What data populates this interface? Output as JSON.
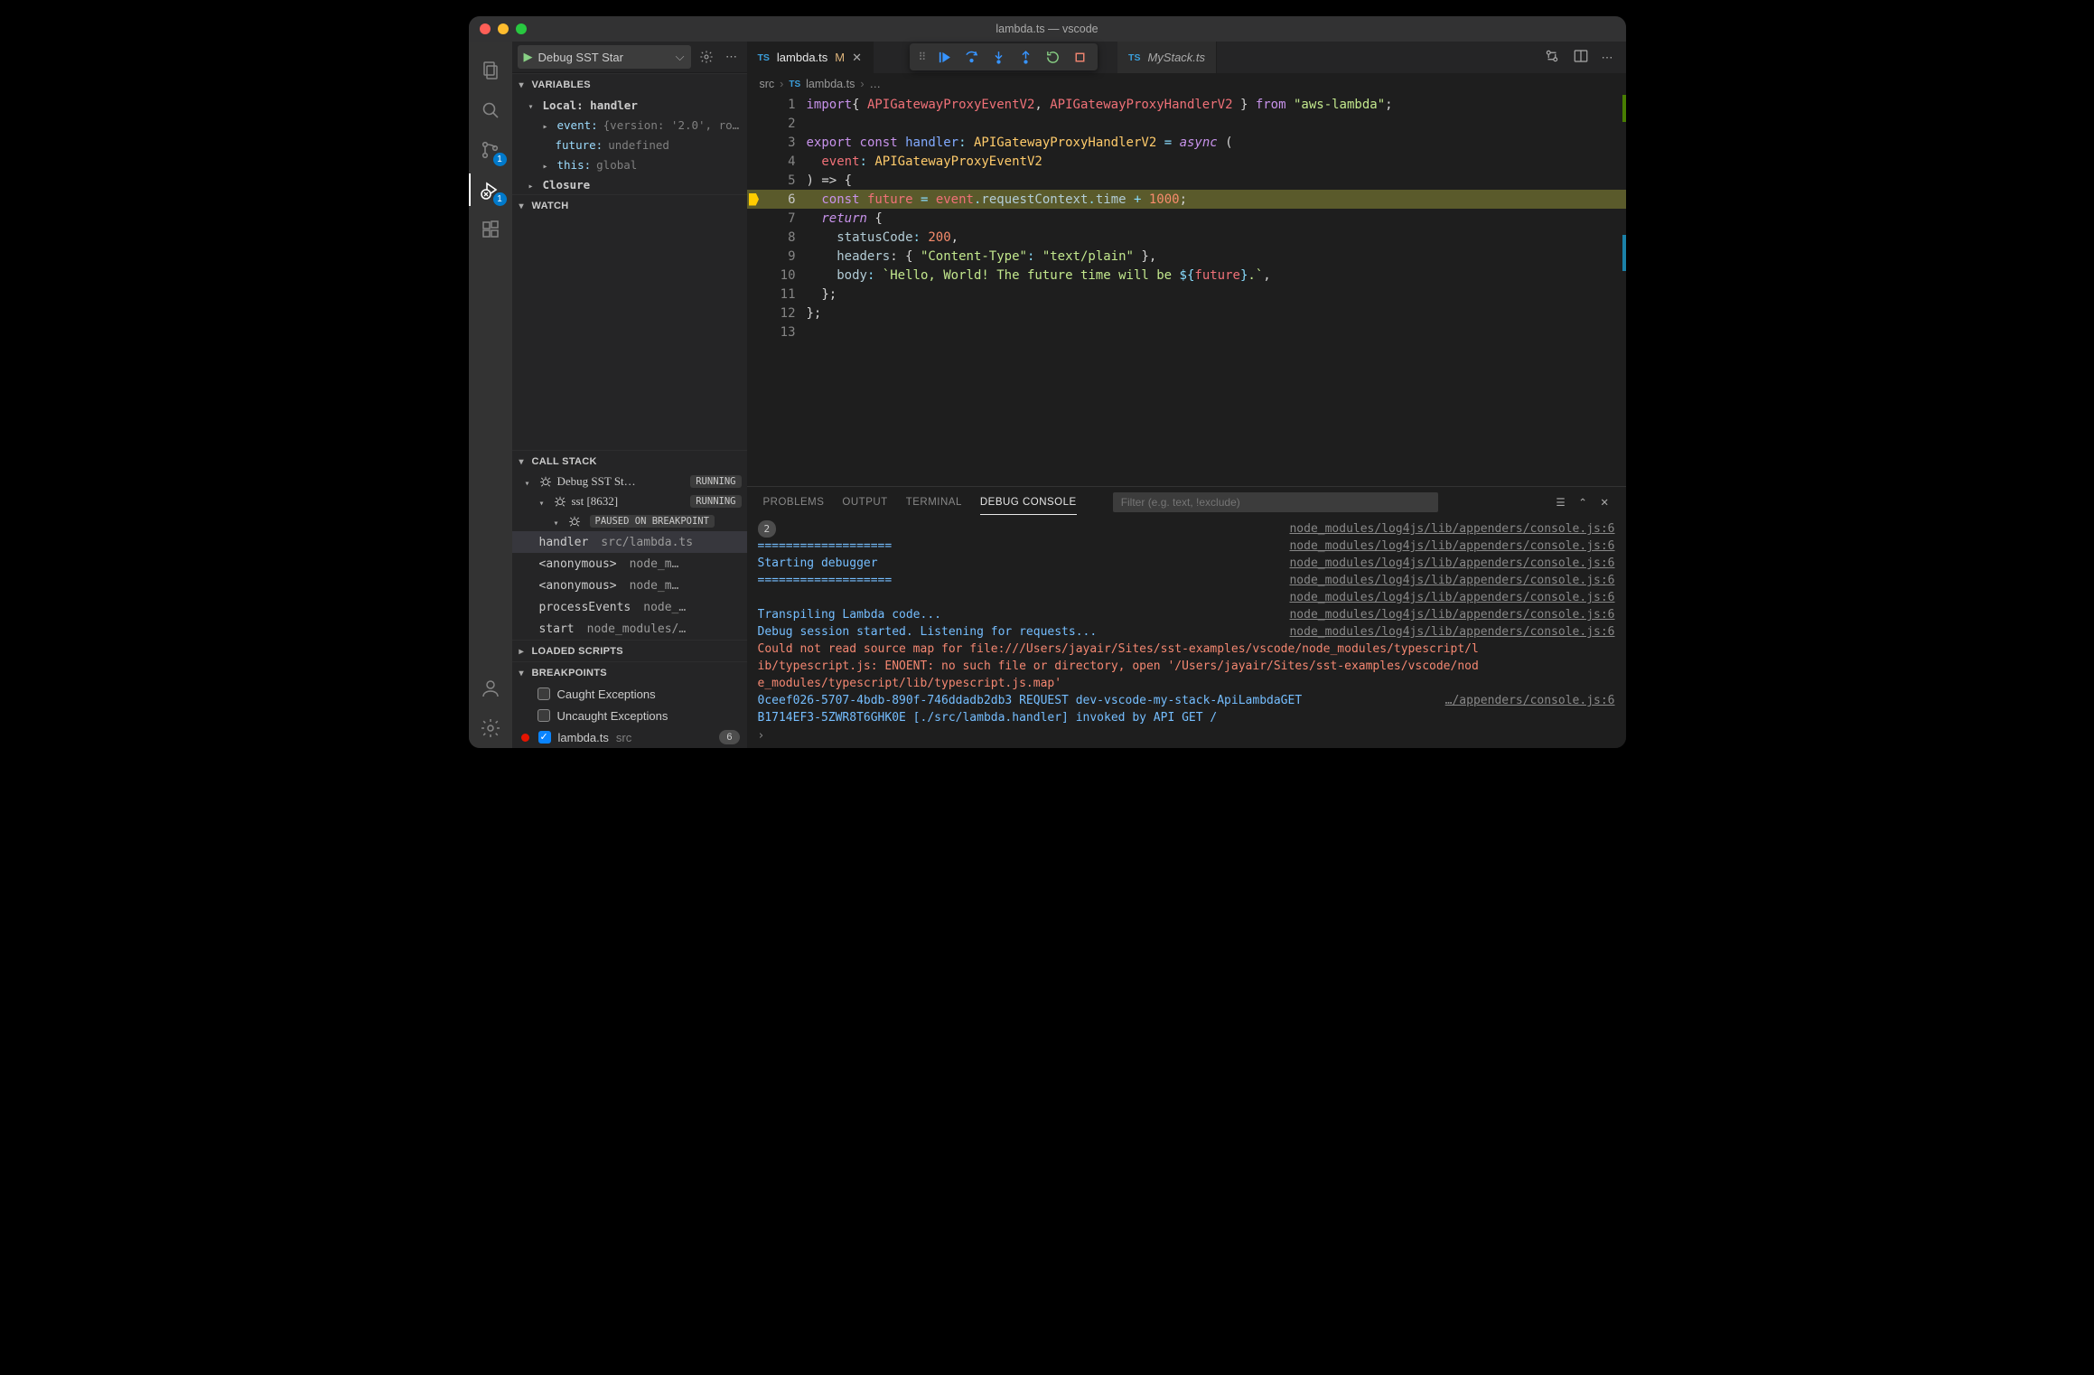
{
  "window_title": "lambda.ts — vscode",
  "activity_badges": {
    "scm": "1",
    "debug": "1"
  },
  "run_config": {
    "label": "Debug SST Star"
  },
  "sections": {
    "variables": "VARIABLES",
    "watch": "WATCH",
    "callstack": "CALL STACK",
    "loaded": "LOADED SCRIPTS",
    "breakpoints": "BREAKPOINTS"
  },
  "variables": {
    "scope": "Local: handler",
    "items": [
      {
        "name": "event:",
        "preview": "{version: '2.0', ro…"
      },
      {
        "name": "future:",
        "preview": "undefined"
      },
      {
        "name": "this:",
        "preview": "global"
      }
    ],
    "closure": "Closure"
  },
  "callstack": {
    "top": {
      "label": "Debug SST St…",
      "state": "RUNNING"
    },
    "proc": {
      "label": "sst [8632]",
      "state": "RUNNING"
    },
    "paused_label": "PAUSED ON BREAKPOINT",
    "frames": [
      {
        "fn": "handler",
        "src": "src/lambda.ts"
      },
      {
        "fn": "<anonymous>",
        "src": "node_m…"
      },
      {
        "fn": "<anonymous>",
        "src": "node_m…"
      },
      {
        "fn": "processEvents",
        "src": "node_…"
      },
      {
        "fn": "start",
        "src": "node_modules/…"
      }
    ]
  },
  "breakpoints": {
    "caught": "Caught Exceptions",
    "uncaught": "Uncaught Exceptions",
    "file": {
      "name": "lambda.ts",
      "folder": "src",
      "count": "6"
    }
  },
  "tabs": {
    "active": {
      "name": "lambda.ts",
      "mod": "M"
    },
    "other": {
      "name": "MyStack.ts"
    }
  },
  "breadcrumb": {
    "a": "src",
    "b": "lambda.ts",
    "c": "…"
  },
  "linenos": [
    "1",
    "2",
    "3",
    "4",
    "5",
    "6",
    "7",
    "8",
    "9",
    "10",
    "11",
    "12",
    "13"
  ],
  "code": {
    "l1": {
      "a": "import",
      "b": "{ ",
      "c": "APIGatewayProxyEventV2",
      "d": ", ",
      "e": "APIGatewayProxyHandlerV2",
      "f": " } ",
      "g": "from",
      "h": " \"aws-lambda\"",
      "i": ";"
    },
    "l3": {
      "a": "export ",
      "b": "const ",
      "c": "handler",
      "d": ": ",
      "e": "APIGatewayProxyHandlerV2",
      "f": " = ",
      "g": "async",
      "h": " ("
    },
    "l4": {
      "a": "  event",
      "b": ": ",
      "c": "APIGatewayProxyEventV2"
    },
    "l5": ") => {",
    "l6": {
      "a": "  const ",
      "b": "future",
      "c": " = ",
      "d": "event",
      "e": ".",
      "f": "requestContext",
      "g": ".",
      "h": "time",
      "i": " + ",
      "j": "1000",
      "k": ";"
    },
    "l7": "  return {",
    "l8": {
      "a": "    statusCode",
      "b": ": ",
      "c": "200",
      "d": ","
    },
    "l9": {
      "a": "    headers",
      "b": ": { ",
      "c": "\"Content-Type\"",
      "d": ": ",
      "e": "\"text/plain\"",
      "f": " },"
    },
    "l10": {
      "a": "    body",
      "b": ": ",
      "c": "`Hello, World! The future time will be ",
      "d": "${",
      "e": "future",
      "f": "}",
      "g": ".`",
      "h": ","
    },
    "l11": "  };",
    "l12": "};"
  },
  "panel": {
    "tabs": {
      "problems": "PROBLEMS",
      "output": "OUTPUT",
      "terminal": "TERMINAL",
      "console": "DEBUG CONSOLE"
    },
    "filter_placeholder": "Filter (e.g. text, !exclude)",
    "repeat_count": "2",
    "console_src": "node_modules/log4js/lib/appenders/console.js:6",
    "short_src": "…/appenders/console.js:6",
    "lines": {
      "sep": "===================",
      "start": " Starting debugger",
      "transpile": "Transpiling Lambda code...",
      "listening": "Debug session started. Listening for requests...",
      "err1": "Could not read source map for file:///Users/jayair/Sites/sst-examples/vscode/node_modules/typescript/l",
      "err2": "ib/typescript.js: ENOENT: no such file or directory, open '/Users/jayair/Sites/sst-examples/vscode/nod",
      "err3": "e_modules/typescript/lib/typescript.js.map'",
      "req1": "0ceef026-5707-4bdb-890f-746ddadb2db3 REQUEST dev-vscode-my-stack-ApiLambdaGET",
      "req2": "B1714EF3-5ZWR8T6GHK0E [./src/lambda.handler] invoked by API GET /"
    }
  }
}
